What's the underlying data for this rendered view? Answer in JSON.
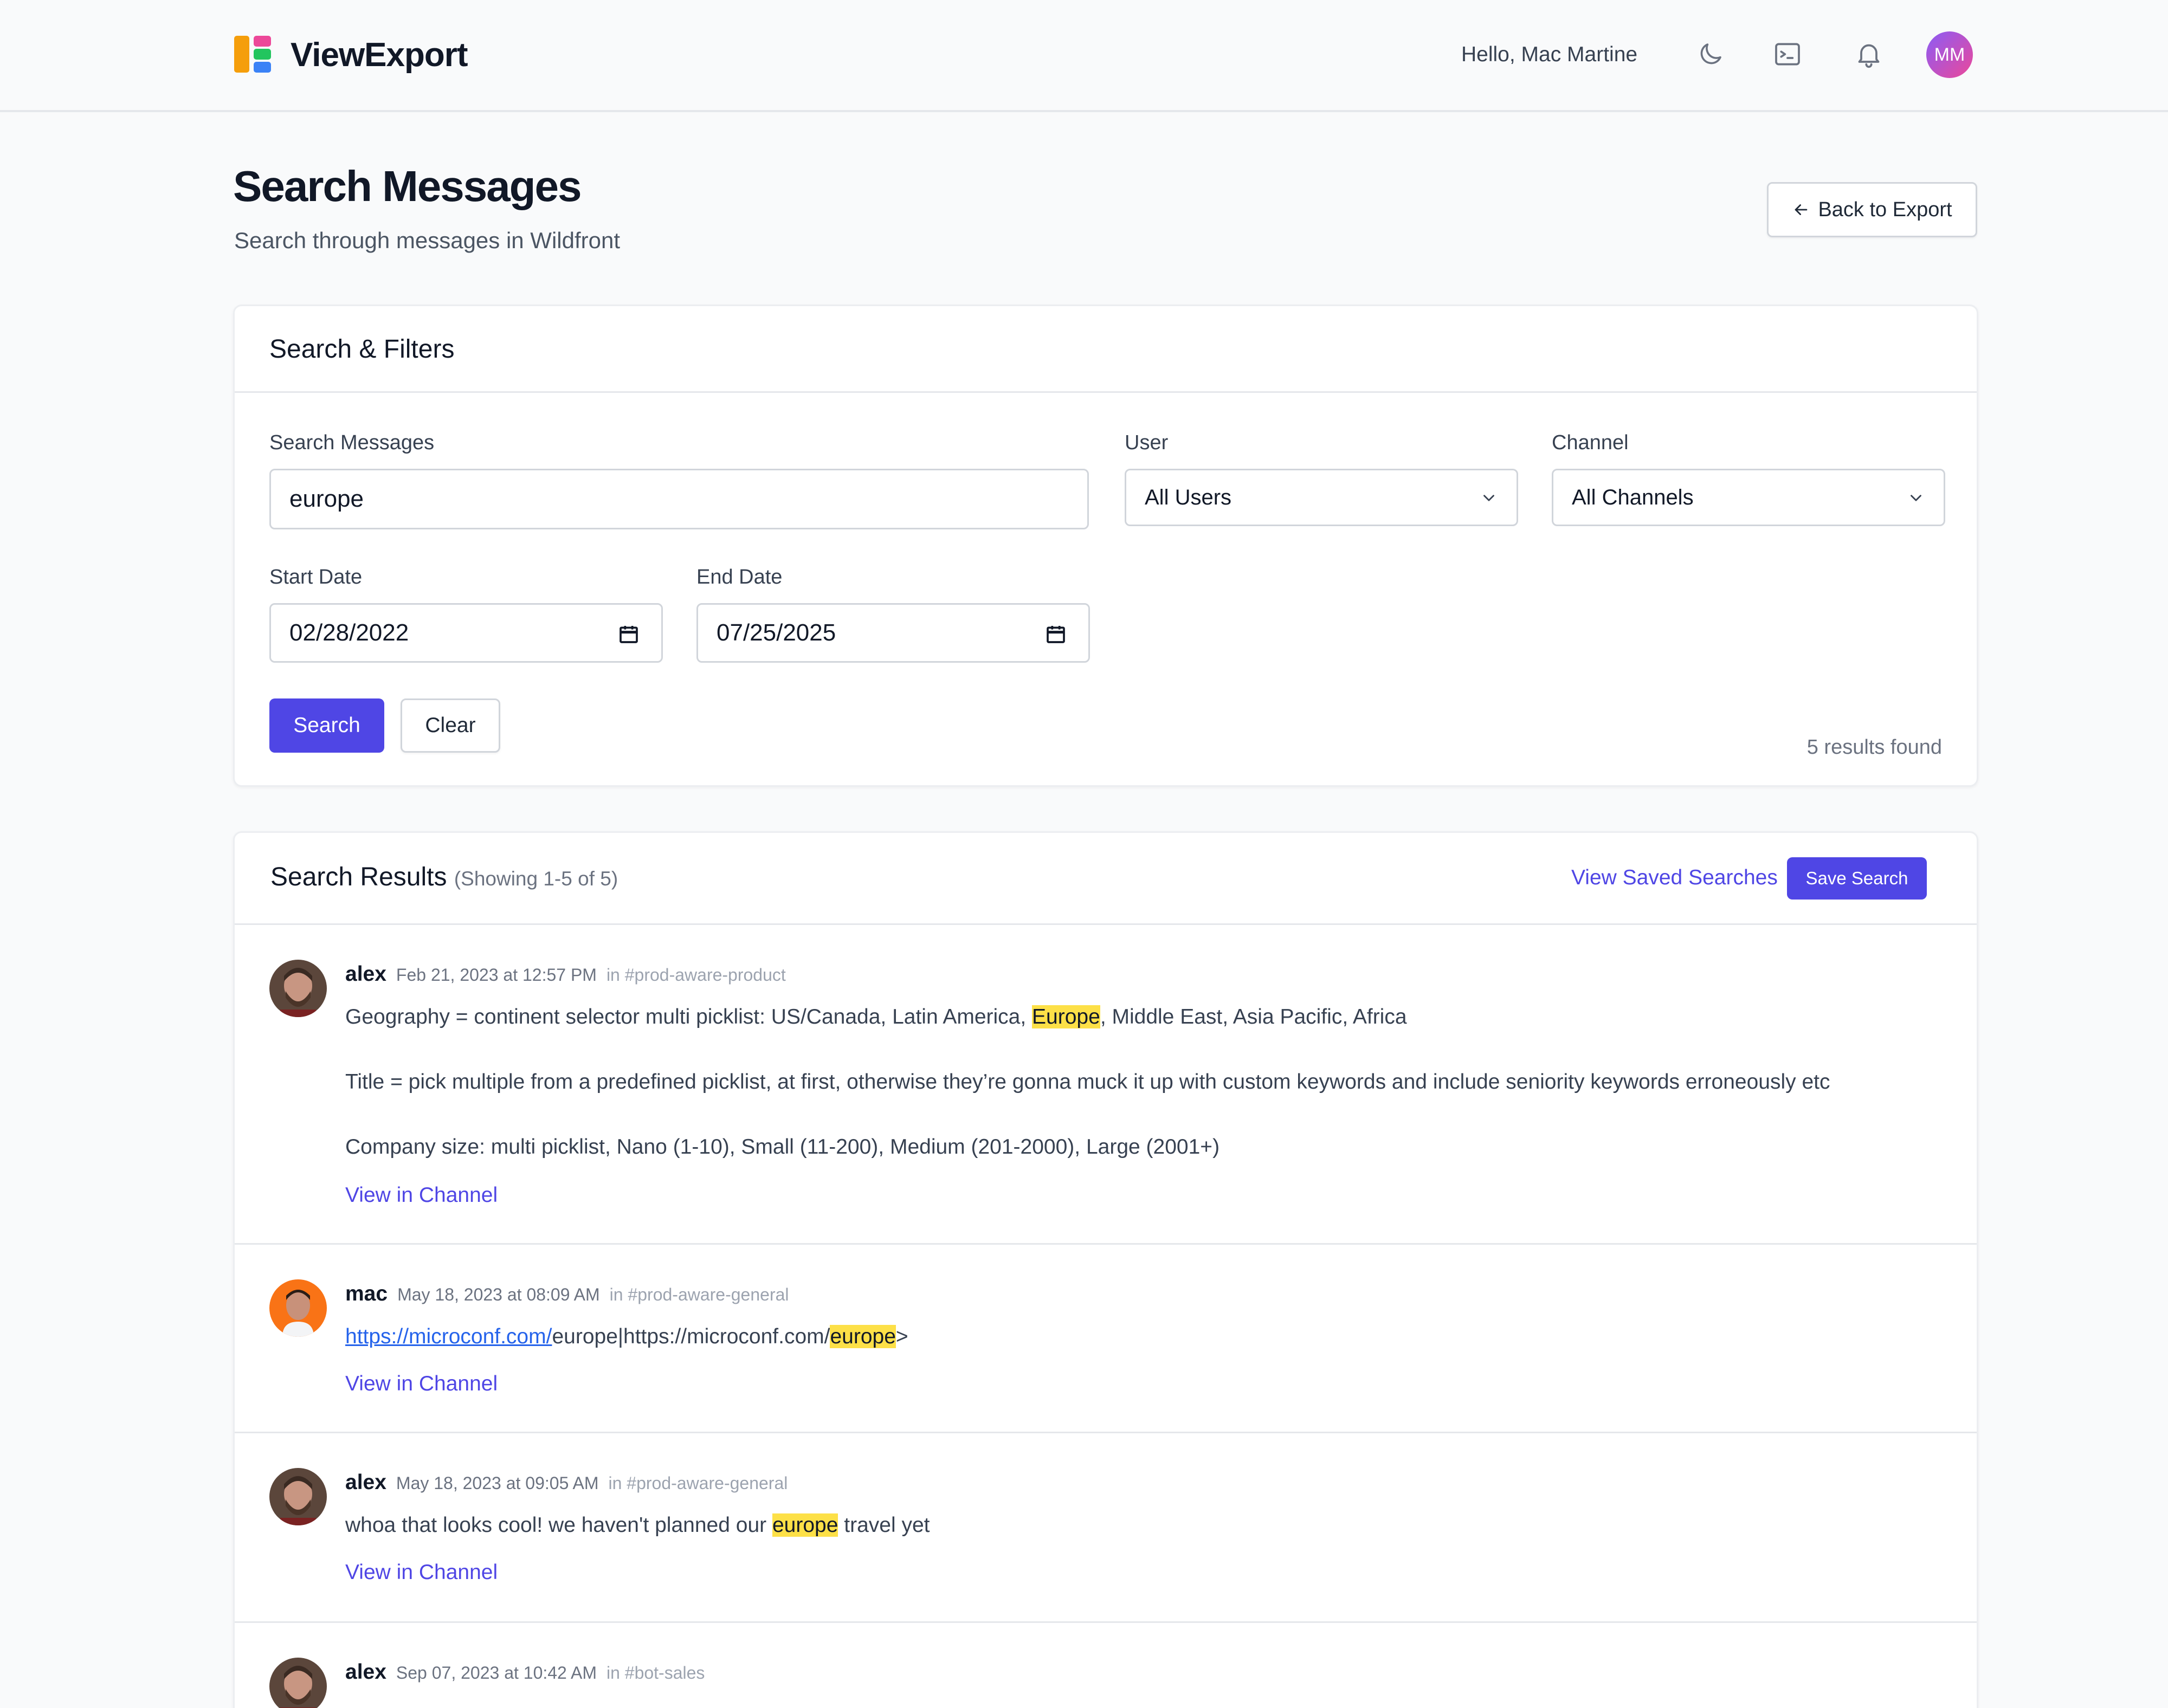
{
  "header": {
    "brand": "ViewExport",
    "greeting": "Hello, Mac Martine",
    "avatar_initials": "MM",
    "logo_colors": [
      "#f59e0b",
      "#ef4444",
      "#ec4899",
      "#22c55e",
      "#3b82f6"
    ]
  },
  "page": {
    "title": "Search Messages",
    "subtitle": "Search through messages in Wildfront",
    "back_label": "Back to Export"
  },
  "filters": {
    "title": "Search & Filters",
    "search_label": "Search Messages",
    "search_value": "europe",
    "user_label": "User",
    "user_value": "All Users",
    "channel_label": "Channel",
    "channel_value": "All Channels",
    "start_label": "Start Date",
    "start_value": "02/28/2022",
    "end_label": "End Date",
    "end_value": "07/25/2025",
    "search_button": "Search",
    "clear_button": "Clear",
    "results_count": "5 results found"
  },
  "results": {
    "title": "Search Results",
    "showing": "(Showing 1-5 of 5)",
    "view_saved": "View Saved Searches",
    "save_search": "Save Search",
    "view_in_channel": "View in Channel",
    "items": [
      {
        "user": "alex",
        "date": "Feb 21, 2023 at 12:57 PM",
        "channel": "in #prod-aware-product",
        "line1_pre": "Geography = continent selector multi picklist: US/Canada, Latin America, ",
        "line1_hl": "Europe",
        "line1_post": ", Middle East, Asia Pacific, Africa",
        "line2": "Title = pick multiple from a predefined picklist, at first, otherwise they’re gonna muck it up with custom keywords and include seniority keywords erroneously etc",
        "line3": "Company size: multi picklist, Nano (1-10), Small (11-200), Medium (201-2000), Large (2001+)"
      },
      {
        "user": "mac",
        "date": "May 18, 2023 at 08:09 AM",
        "channel": "in #prod-aware-general",
        "link": "https://microconf.com/",
        "text_mid": "europe|https://microconf.com/",
        "text_hl": "europe",
        "text_post": ">"
      },
      {
        "user": "alex",
        "date": "May 18, 2023 at 09:05 AM",
        "channel": "in #prod-aware-general",
        "text_pre": "whoa that looks cool! we haven't planned our ",
        "text_hl": "europe",
        "text_post": " travel yet"
      },
      {
        "user": "alex",
        "date": "Sep 07, 2023 at 10:42 AM",
        "channel": "in #bot-sales"
      }
    ]
  }
}
